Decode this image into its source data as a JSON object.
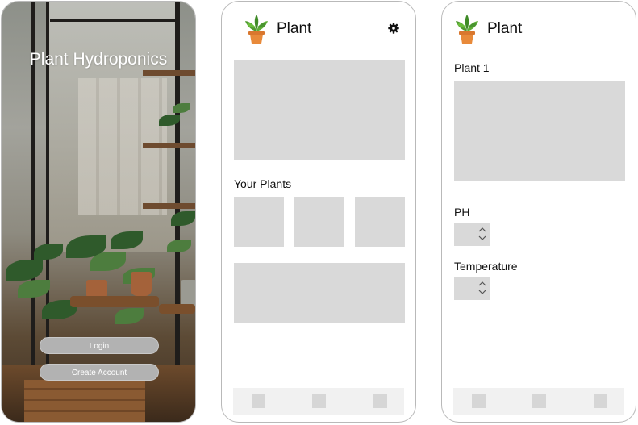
{
  "login": {
    "title": "Plant Hydroponics",
    "login_label": "Login",
    "create_account_label": "Create Account"
  },
  "home": {
    "app_title": "Plant",
    "section_your_plants": "Your Plants",
    "tabs": [
      "tab-1",
      "tab-2",
      "tab-3"
    ]
  },
  "detail": {
    "app_title": "Plant",
    "plant_name": "Plant 1",
    "ph_label": "PH",
    "temperature_label": "Temperature",
    "tabs": [
      "tab-1",
      "tab-2",
      "tab-3"
    ]
  },
  "icons": [
    "potted-plant-icon",
    "gear-icon",
    "chevron-up-icon",
    "chevron-down-icon"
  ],
  "colors": {
    "placeholder": "#d9d9d9",
    "button": "#b2b2b2",
    "frame_border": "#b9b9b9"
  }
}
